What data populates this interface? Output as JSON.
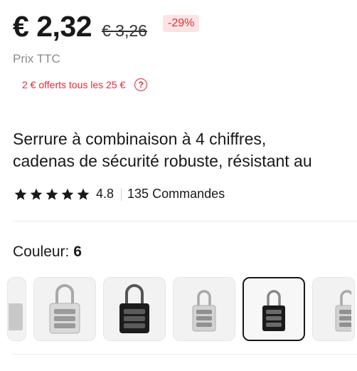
{
  "price": {
    "current": "€ 2,32",
    "original": "€ 3,26",
    "discount": "-29%",
    "tax_label": "Prix TTC"
  },
  "coupon": {
    "text": "2 € offerts tous les 25 €",
    "help_icon": "question-circle-icon"
  },
  "product": {
    "title_line1": "Serrure à combinaison à 4 chiffres,",
    "title_line2": "cadenas de sécurité robuste, résistant au"
  },
  "rating": {
    "value": "4.8",
    "stars": 5,
    "orders": "135 Commandes"
  },
  "variant": {
    "label": "Couleur:",
    "count": "6",
    "options": [
      {
        "name": "silver-partial",
        "color": "silver"
      },
      {
        "name": "silver",
        "color": "silver"
      },
      {
        "name": "black",
        "color": "black"
      },
      {
        "name": "silver-small",
        "color": "silver"
      },
      {
        "name": "black-selected",
        "color": "black",
        "selected": true
      },
      {
        "name": "silver-partial-right",
        "color": "silver"
      }
    ]
  },
  "colors": {
    "accent_red": "#e12d39",
    "badge_bg": "#fde4e4",
    "text": "#191919",
    "muted": "#8a8a8a"
  }
}
